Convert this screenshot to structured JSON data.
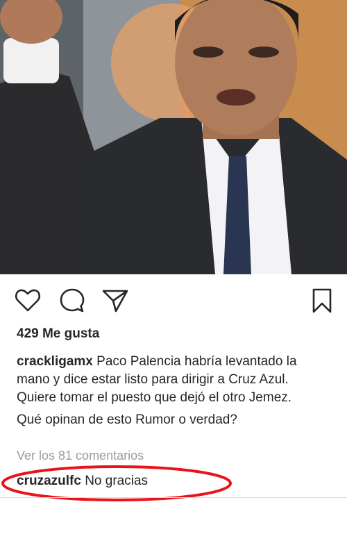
{
  "post": {
    "likes_text": "429 Me gusta",
    "caption_user": "crackligamx",
    "caption_text": "Paco Palencia habría levantado la mano y dice estar listo para dirigir a Cruz Azul. Quiere tomar el puesto que dejó el otro Jemez.",
    "caption_question": "Qué opinan de esto Rumor o verdad?",
    "view_comments": "Ver los 81 comentarios",
    "comment_user": "cruzazulfc",
    "comment_text": "No gracias"
  },
  "icons": {
    "like": "heart-icon",
    "comment": "comment-bubble-icon",
    "share": "paper-plane-icon",
    "save": "bookmark-icon"
  },
  "colors": {
    "text": "#262626",
    "muted": "#9b9b9b",
    "highlight": "#e8141b"
  }
}
